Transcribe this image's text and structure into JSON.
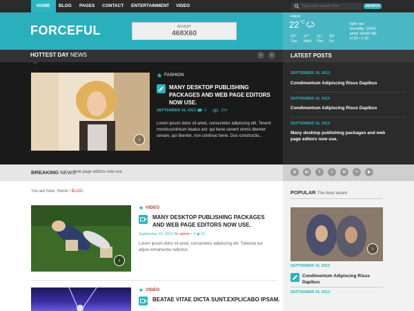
{
  "nav": {
    "items": [
      "HOME",
      "BLOG",
      "PAGES",
      "CONTACT",
      "ENTERTAINMENT",
      "VIDEO"
    ]
  },
  "search": {
    "placeholder": "Type your search here",
    "button": "SEARCH"
  },
  "header": {
    "logo": "FORCEFUL",
    "advert_label": "ADVERT",
    "advert_size": "468X60"
  },
  "weather": {
    "city": "Hanoi",
    "temp": "22",
    "unit": "°C",
    "icon": "cloud-rain-icon",
    "details": [
      "light rain",
      "humidity: 100%",
      "wind: 1km/h NE",
      "H 22 • L 22"
    ],
    "forecast": [
      {
        "temp": "22°",
        "day": "Tue"
      },
      {
        "temp": "17°",
        "day": "Wed"
      },
      {
        "temp": "21°",
        "day": "Thu"
      },
      {
        "temp": "25°",
        "day": "Fri"
      }
    ]
  },
  "hottest": {
    "title_bold": "HOTTEST DAY",
    "title_light": "NEWS",
    "category": "FASHION",
    "post_title": "MANY DESKTOP PUBLISHING PACKAGES AND WEB PAGE EDITORS NOW USE.",
    "date": "SEPTEMBER 16, 2013",
    "comments": "0",
    "views": "224",
    "excerpt": "Lorem ipsum dolor sit amet, consectetur adipiscing elit. Tenent mordicusnimium beatus est: qui bene cenent omnis libenter cenare, qui libenter, non continuo bene. Duo constructio..."
  },
  "latest": {
    "heading": "LATEST POSTS",
    "items": [
      {
        "date": "SEPTEMBER 16, 2013",
        "title": "Condimentum Adipiscing Risus Dapibus"
      },
      {
        "date": "SEPTEMBER 16, 2013",
        "title": "Condimentum Adipiscing Risus Dapibus"
      },
      {
        "date": "SEPTEMBER 16, 2013",
        "title": "Many desktop publishing packages and web page editors now use."
      }
    ]
  },
  "breaking": {
    "label_bold": "BREAKING",
    "label_light": "NEWS",
    "text": "web page editors now use."
  },
  "social": [
    "dribbble-icon",
    "google-plus-icon",
    "facebook-icon",
    "twitter-icon",
    "linkedin-icon",
    "flickr-icon",
    "youtube-icon"
  ],
  "breadcrumb": {
    "prefix": "You are here:",
    "home": "Home",
    "sep": "/",
    "current": "BLOG"
  },
  "posts": [
    {
      "category": "VIDEO",
      "title": "MANY DESKTOP PUBLISHING PACKAGES AND WEB PAGE EDITORS NOW USE.",
      "date": "September 16, 2013",
      "by": "By",
      "author": "admin",
      "comments": "0",
      "views": "61",
      "excerpt": "Lorem ipsum dolor sit amet, consectetur adipiscing elit. Tollenda est atque extrahenda radicitus."
    },
    {
      "category": "VIDEO",
      "title": "BEATAE VITAE DICTA SUNT.EXPLICABO IPSAM."
    }
  ],
  "popular": {
    "heading_bold": "POPULAR",
    "heading_light": "The most recent",
    "date": "SEPTEMBER 16, 2013",
    "title": "Condimentum Adipiscing Risus Dapibus",
    "date2": "SEPTEMBER 16, 2013"
  },
  "colors": {
    "accent": "#2bb5c1",
    "dark": "#1a1a1a",
    "category": "#c0392b"
  }
}
